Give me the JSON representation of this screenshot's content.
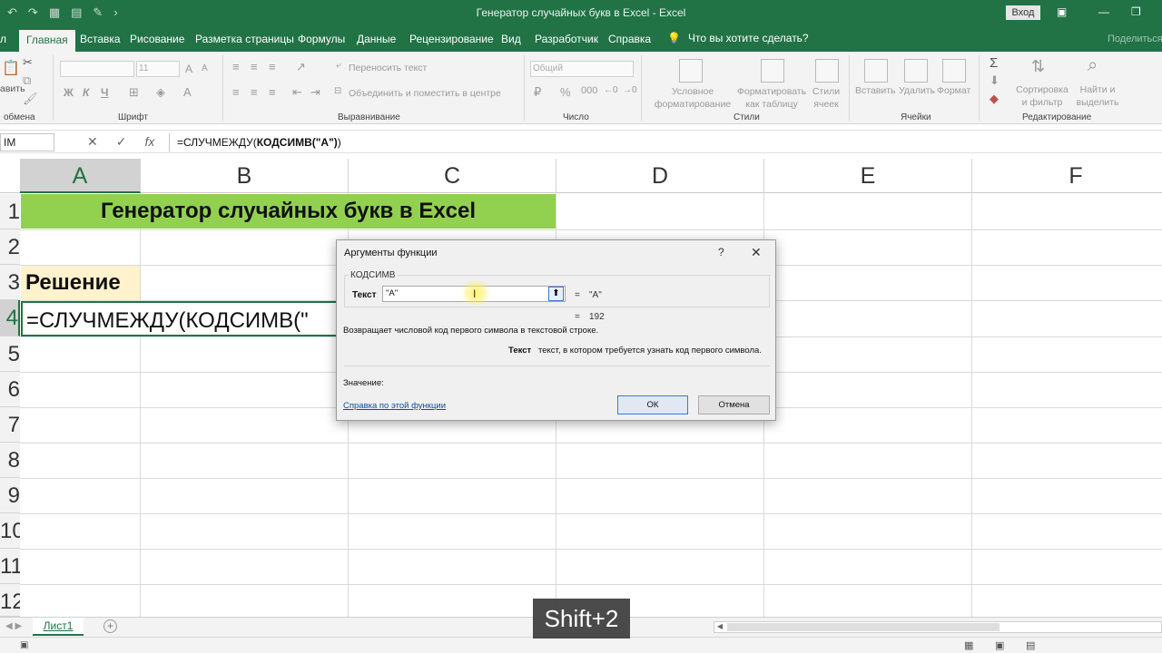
{
  "window": {
    "title": "Генератор случайных букв в Excel  -  Excel",
    "login_label": "Вход",
    "restore_icon": "restore-icon"
  },
  "ribbon_tabs": [
    {
      "label": "Главная"
    },
    {
      "label": "Вставка"
    },
    {
      "label": "Рисование"
    },
    {
      "label": "Разметка страницы"
    },
    {
      "label": "Формулы"
    },
    {
      "label": "Данные"
    },
    {
      "label": "Рецензирование"
    },
    {
      "label": "Вид"
    },
    {
      "label": "Разработчик"
    },
    {
      "label": "Справка"
    }
  ],
  "file_tab_fragment": "л",
  "tell_me": "Что вы хотите сделать?",
  "share_label": "Поделиться",
  "ribbon": {
    "clipboard": {
      "paste_fragment": "авить",
      "label": "обмена"
    },
    "font": {
      "label": "Шрифт",
      "size": "11",
      "bold": "Ж",
      "italic": "К",
      "underline": "Ч",
      "grow": "A",
      "shrink": "A"
    },
    "alignment": {
      "label": "Выравнивание",
      "wrap": "Переносить текст",
      "merge": "Объединить и поместить в центре"
    },
    "number": {
      "label": "Число",
      "format": "Общий"
    },
    "styles": {
      "label": "Стили",
      "conditional": "Условное форматирование",
      "format_table": "Форматировать как таблицу",
      "cell_styles": "Стили ячеек"
    },
    "cells": {
      "label": "Ячейки",
      "insert": "Вставить",
      "delete": "Удалить",
      "format": "Формат"
    },
    "editing": {
      "label": "Редактирование",
      "sort": "Сортировка и фильтр",
      "find": "Найти и выделить"
    }
  },
  "formula_bar": {
    "name_box": "IM",
    "formula_prefix": "=СЛУЧМЕЖДУ(",
    "formula_bold": "КОДСИМВ(\"A\")",
    "formula_suffix": ")"
  },
  "grid": {
    "columns": [
      "A",
      "B",
      "C",
      "D",
      "E",
      "F"
    ],
    "rows": [
      "1",
      "2",
      "3",
      "4",
      "5",
      "6",
      "7",
      "8",
      "9",
      "10",
      "11",
      "12"
    ],
    "title_cell": "Генератор случайных букв в Excel",
    "solution_cell": "Решение",
    "editing_cell": "=СЛУЧМЕЖДУ(КОДСИМВ(\""
  },
  "dialog": {
    "title": "Аргументы функции",
    "help": "?",
    "close": "✕",
    "function_name": "КОДСИМВ",
    "arg_label": "Текст",
    "arg_value": "\"A\"",
    "arg_eq": "=",
    "arg_result": "\"A\"",
    "result_eq": "=",
    "result_value": "192",
    "description": "Возвращает числовой код первого символа в текстовой строке.",
    "arg_help_name": "Текст",
    "arg_help_text": "текст, в котором требуется узнать код первого символа.",
    "value_label": "Значение:",
    "help_link": "Справка по этой функции",
    "ok": "ОК",
    "cancel": "Отмена"
  },
  "sheets": [
    {
      "name": "Лист1"
    }
  ],
  "key_hint": "Shift+2",
  "colors": {
    "excel_green": "#217346",
    "title_fill": "#92d050",
    "solution_fill": "#fff2cc"
  }
}
